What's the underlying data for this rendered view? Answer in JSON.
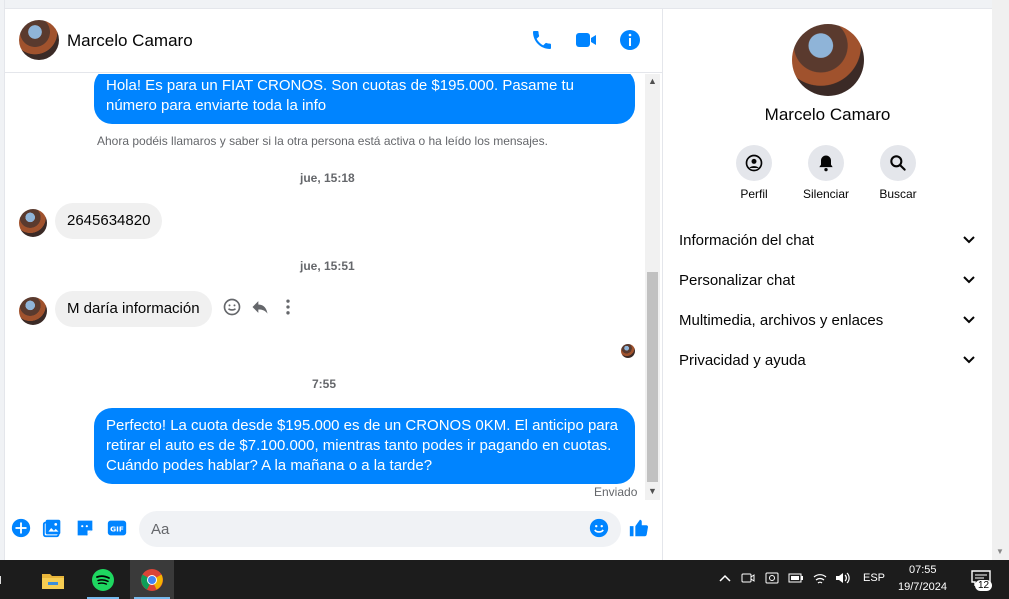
{
  "chat": {
    "contact_name": "Marcelo Camaro",
    "messages": {
      "out1": "Hola! Es para un FIAT CRONOS. Son cuotas de $195.000. Pasame tu número para enviarte toda la info",
      "info": "Ahora podéis llamaros y saber si la otra persona está activa o ha leído los mensajes.",
      "time1": "jue, 15:18",
      "in1": "2645634820",
      "time2": "jue, 15:51",
      "in2": "M daría información",
      "time3": "7:55",
      "out2": "Perfecto! La cuota desde $195.000 es de un CRONOS 0KM. El anticipo para retirar el auto es de $7.100.000, mientras tanto podes ir pagando en cuotas. Cuándo podes hablar? A la mañana o a la tarde?",
      "sent": "Enviado"
    },
    "composer": {
      "placeholder": "Aa",
      "gif_label": "GIF"
    },
    "colors": {
      "accent": "#0084ff"
    }
  },
  "panel": {
    "name": "Marcelo Camaro",
    "actions": [
      "Perfil",
      "Silenciar",
      "Buscar"
    ],
    "sections": [
      "Información del chat",
      "Personalizar chat",
      "Multimedia, archivos y enlaces",
      "Privacidad y ayuda"
    ]
  },
  "taskbar": {
    "language": "ESP",
    "time": "07:55",
    "date": "19/7/2024",
    "notifications": "12"
  }
}
